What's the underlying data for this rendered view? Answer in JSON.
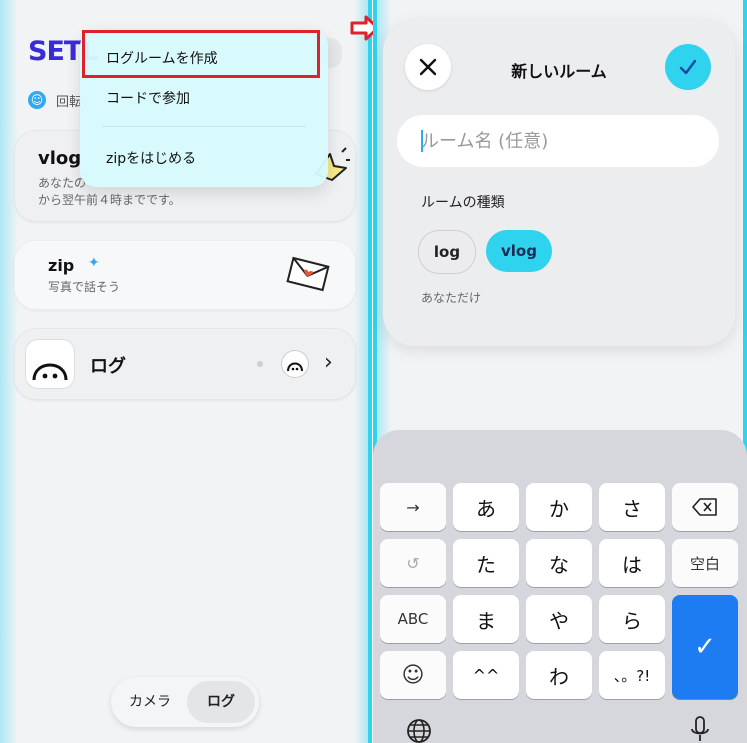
{
  "left": {
    "logo": "SETL",
    "status_text": "回転",
    "menu": {
      "items": [
        "ログルームを作成",
        "コードで参加",
        "zipをはじめる"
      ]
    },
    "vlog_card": {
      "title": "vlog",
      "desc_line1": "あなたの",
      "desc_line2": "から翌午前４時までです。"
    },
    "zip_card": {
      "title": "zip",
      "subtitle": "写真で話そう"
    },
    "log_row": {
      "title": "ログ"
    },
    "segmented": {
      "camera": "カメラ",
      "log": "ログ"
    }
  },
  "arrow": {
    "color": "#e0202a"
  },
  "right": {
    "dialog": {
      "title": "新しいルーム",
      "name_placeholder": "ルーム名 (任意)",
      "type_label": "ルームの種類",
      "types": [
        "log",
        "vlog"
      ],
      "selected_type": "vlog",
      "visibility_note": "あなただけ"
    },
    "keyboard": {
      "row1": [
        "→",
        "あ",
        "か",
        "さ",
        "⌫"
      ],
      "row2": [
        "↺",
        "た",
        "な",
        "は",
        "空白"
      ],
      "row3": [
        "ABC",
        "ま",
        "や",
        "ら"
      ],
      "row4": [
        "☺",
        "^^",
        "わ",
        "、。?!"
      ],
      "enter": "✓"
    }
  },
  "colors": {
    "accent_cyan": "#2fd3ee",
    "brand_indigo": "#3a2bd8",
    "highlight_red": "#e0202a",
    "confirm_blue": "#1d7cf2"
  }
}
